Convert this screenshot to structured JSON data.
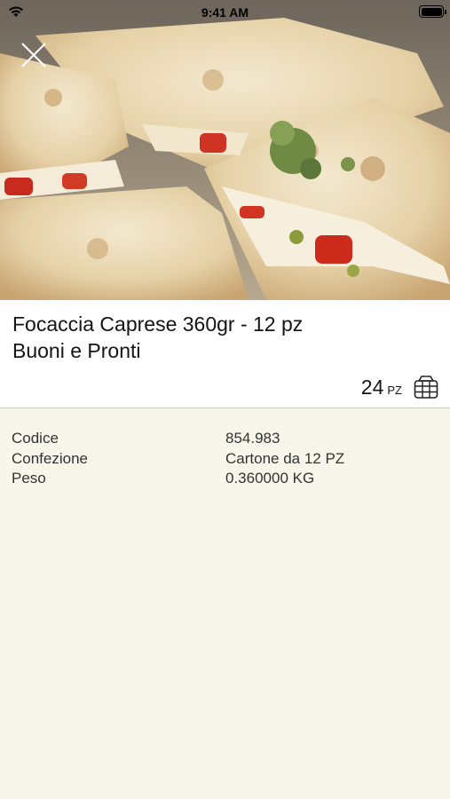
{
  "status_bar": {
    "time": "9:41 AM"
  },
  "hero": {
    "image": "focaccia-caprese-photo"
  },
  "product": {
    "title_line1": "Focaccia Caprese 360gr - 12 pz",
    "title_line2": "Buoni e Pronti",
    "quantity": "24",
    "quantity_unit": "PZ"
  },
  "details": [
    {
      "label": "Codice",
      "value": "854.983"
    },
    {
      "label": "Confezione",
      "value": "Cartone da 12 PZ"
    },
    {
      "label": "Peso",
      "value": "0.360000 KG"
    }
  ],
  "icons": {
    "close": "close-icon",
    "basket": "basket-icon",
    "wifi": "wifi-icon",
    "battery": "battery-icon"
  }
}
